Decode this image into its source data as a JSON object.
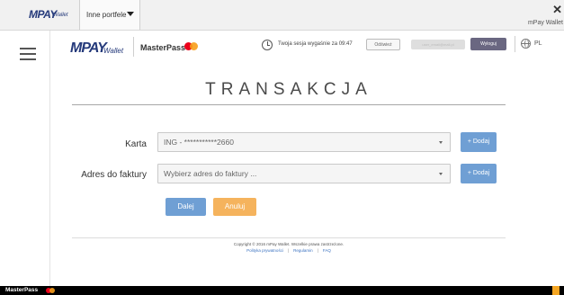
{
  "outer": {
    "logo_mpay": "MPAY",
    "logo_wallet": "Wallet",
    "wallet_select": "Inne portfele",
    "close": "✕",
    "brand": "mPay Wallet"
  },
  "header": {
    "logo_mpay": "MPAY",
    "logo_wallet": "Wallet",
    "masterpass": "MasterPass",
    "session_text": "Twoja sesja wygaśnie za  09:47",
    "refresh": "Odśwież",
    "user_email": "user_email@mail.pl",
    "logout": "Wyloguj",
    "language": "PL"
  },
  "page": {
    "title": "TRANSAKCJA"
  },
  "form": {
    "card_label": "Karta",
    "card_value": "ING - ***********2660",
    "card_add": "+ Dodaj",
    "invoice_label": "Adres do faktury",
    "invoice_placeholder": "Wybierz adres do faktury ...",
    "invoice_add": "+ Dodaj",
    "next": "Dalej",
    "cancel": "Anuluj"
  },
  "footer": {
    "copyright": "Copyright © 2016 mPay Wallet. Wszelkie prawa zastrzeżone.",
    "links": [
      "Polityka prywatności",
      "Regulamin",
      "FAQ"
    ]
  },
  "bottom": {
    "masterpass": "MasterPass"
  },
  "colors": {
    "primary_blue": "#6f9fd4",
    "cancel_orange": "#f5b35d",
    "logout_purple": "#6a6781",
    "brand_navy": "#24397a"
  }
}
